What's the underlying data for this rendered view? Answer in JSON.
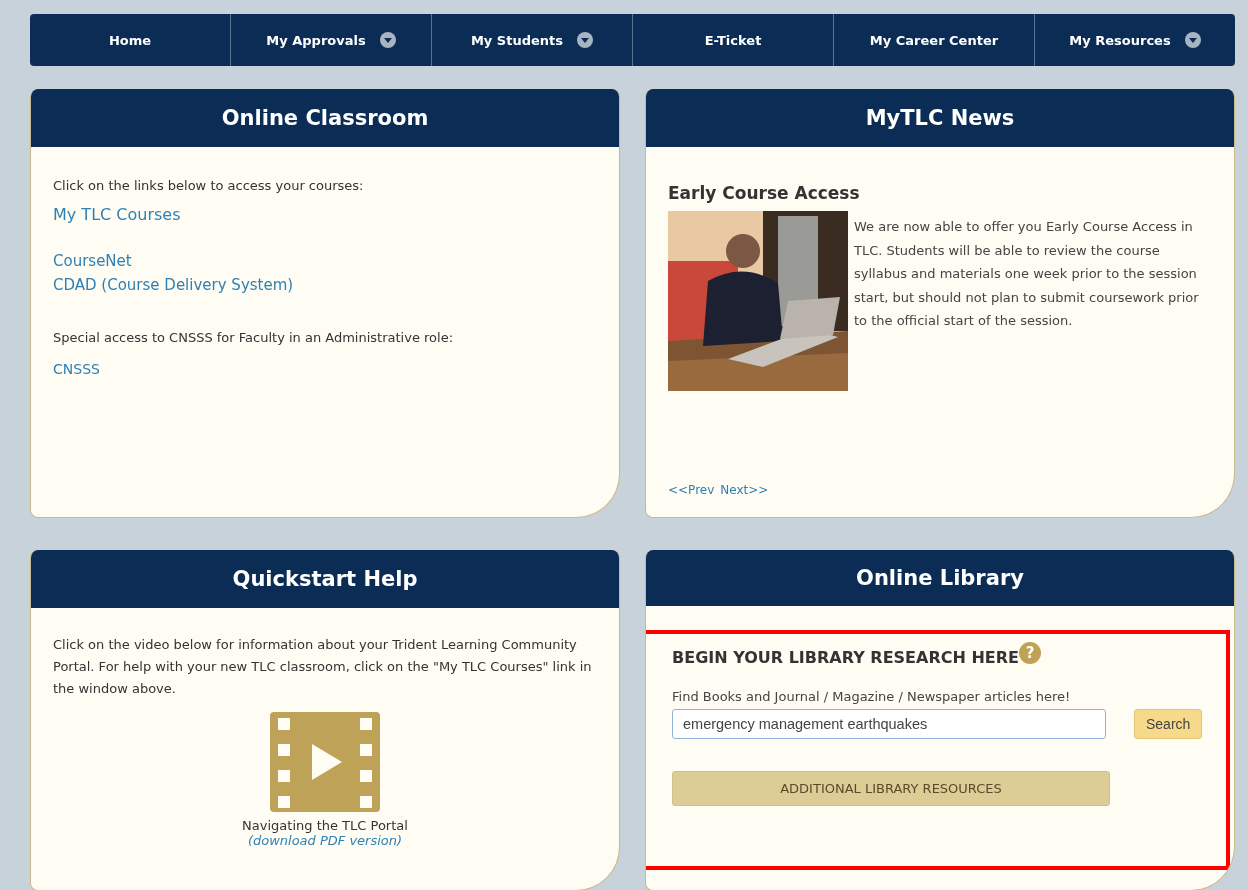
{
  "nav": [
    {
      "label": "Home",
      "dropdown": false
    },
    {
      "label": "My Approvals",
      "dropdown": true
    },
    {
      "label": "My Students",
      "dropdown": true
    },
    {
      "label": "E-Ticket",
      "dropdown": false
    },
    {
      "label": "My Career Center",
      "dropdown": false
    },
    {
      "label": "My Resources",
      "dropdown": true
    }
  ],
  "online_classroom": {
    "title": "Online Classroom",
    "intro": "Click on the links below to access your courses:",
    "links": [
      {
        "label": "My TLC Courses",
        "large": true
      },
      {
        "label": "CourseNet",
        "large": false
      },
      {
        "label": "CDAD (Course Delivery System)",
        "large": false
      }
    ],
    "special_note": "Special access to CNSSS for Faculty in an Administrative role:",
    "special_link": "CNSSS"
  },
  "mytlc_news": {
    "title": "MyTLC News",
    "headline": "Early Course Access",
    "body": "We are now able to offer you Early Course Access in TLC. Students will be able to review the course syllabus and materials one week prior to the session start, but should not plan to submit coursework prior to the official start of the session.",
    "prev": "<<Prev",
    "next": "Next>>"
  },
  "quickstart_help": {
    "title": "Quickstart Help",
    "text": "Click on the video below for information about your Trident Learning Community Portal. For help with your new TLC classroom, click on the \"My TLC Courses\" link in the window above.",
    "video_caption": "Navigating the TLC Portal",
    "pdf_link": "(download PDF version)"
  },
  "online_library": {
    "title": "Online Library",
    "highlighted": true,
    "heading": "BEGIN YOUR LIBRARY RESEARCH HERE",
    "help_badge": "?",
    "hint": "Find Books and Journal / Magazine / Newspaper articles here!",
    "search_value": "emergency management earthquakes",
    "search_button": "Search",
    "resources_button": "ADDITIONAL LIBRARY RESOURCES"
  }
}
